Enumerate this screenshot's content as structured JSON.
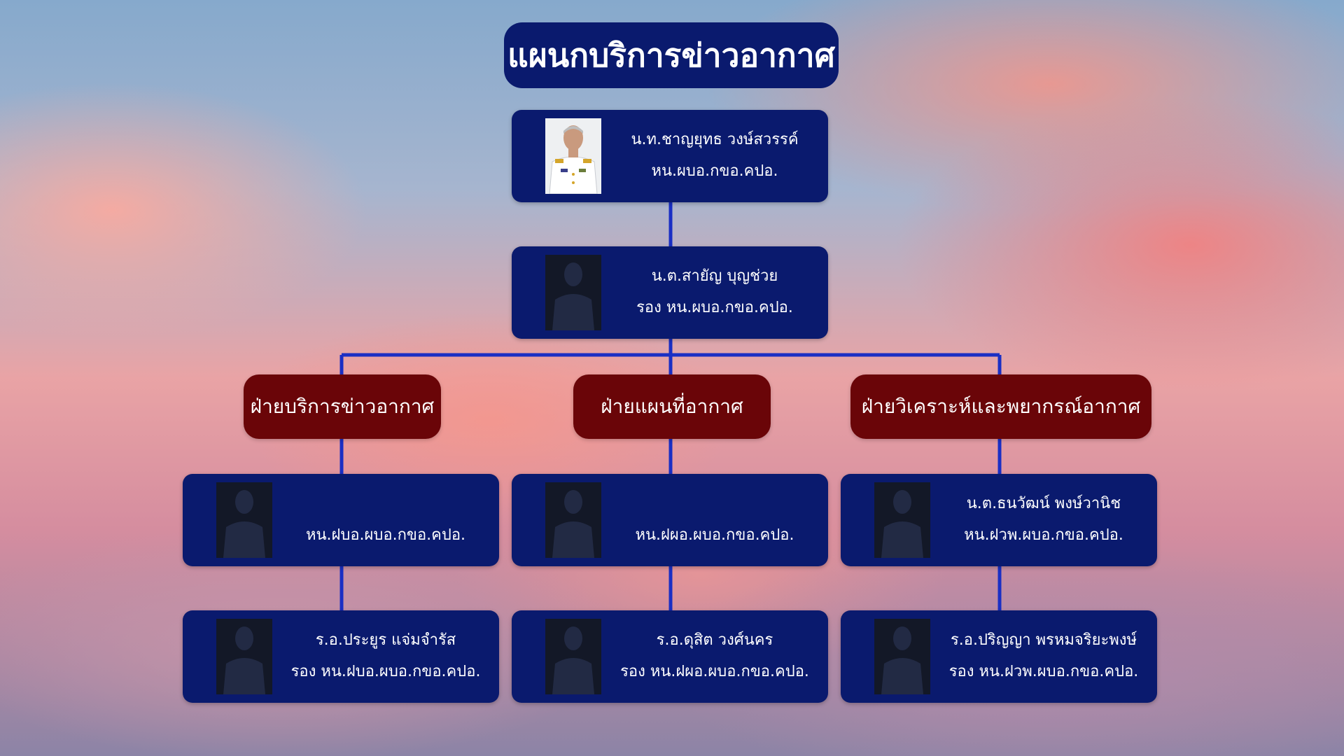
{
  "title": "แผนกบริการข่าวอากาศ",
  "head": {
    "name": "น.ท.ชาญยุทธ วงษ์สวรรค์",
    "position": "หน.ผบอ.กขอ.คปอ."
  },
  "deputy": {
    "name": "น.ต.สายัญ บุญช่วย",
    "position": "รอง หน.ผบอ.กขอ.คปอ."
  },
  "sections": [
    {
      "label": "ฝ่ายบริการข่าวอากาศ",
      "chief": {
        "name": "",
        "position": "หน.ฝบอ.ผบอ.กขอ.คปอ."
      },
      "deputy": {
        "name": "ร.อ.ประยูร แจ่มจำรัส",
        "position": "รอง หน.ฝบอ.ผบอ.กขอ.คปอ."
      }
    },
    {
      "label": "ฝ่ายแผนที่อากาศ",
      "chief": {
        "name": "",
        "position": "หน.ฝผอ.ผบอ.กขอ.คปอ."
      },
      "deputy": {
        "name": "ร.อ.ดุสิต วงศ์นคร",
        "position": "รอง หน.ฝผอ.ผบอ.กขอ.คปอ."
      }
    },
    {
      "label": "ฝ่ายวิเคราะห์และพยากรณ์อากาศ",
      "chief": {
        "name": "น.ต.ธนวัฒน์ พงษ์วานิช",
        "position": "หน.ฝวพ.ผบอ.กขอ.คปอ."
      },
      "deputy": {
        "name": "ร.อ.ปริญญา พรหมจริยะพงษ์",
        "position": "รอง หน.ฝวพ.ผบอ.กขอ.คปอ."
      }
    }
  ],
  "colors": {
    "card_fill": "#0a1a6e",
    "section_fill": "#6a0508",
    "connector": "#1a2fc4",
    "text": "#ffffff"
  },
  "icons": {
    "placeholder_photo": "person-silhouette-icon",
    "head_photo": "officer-portrait-icon"
  }
}
